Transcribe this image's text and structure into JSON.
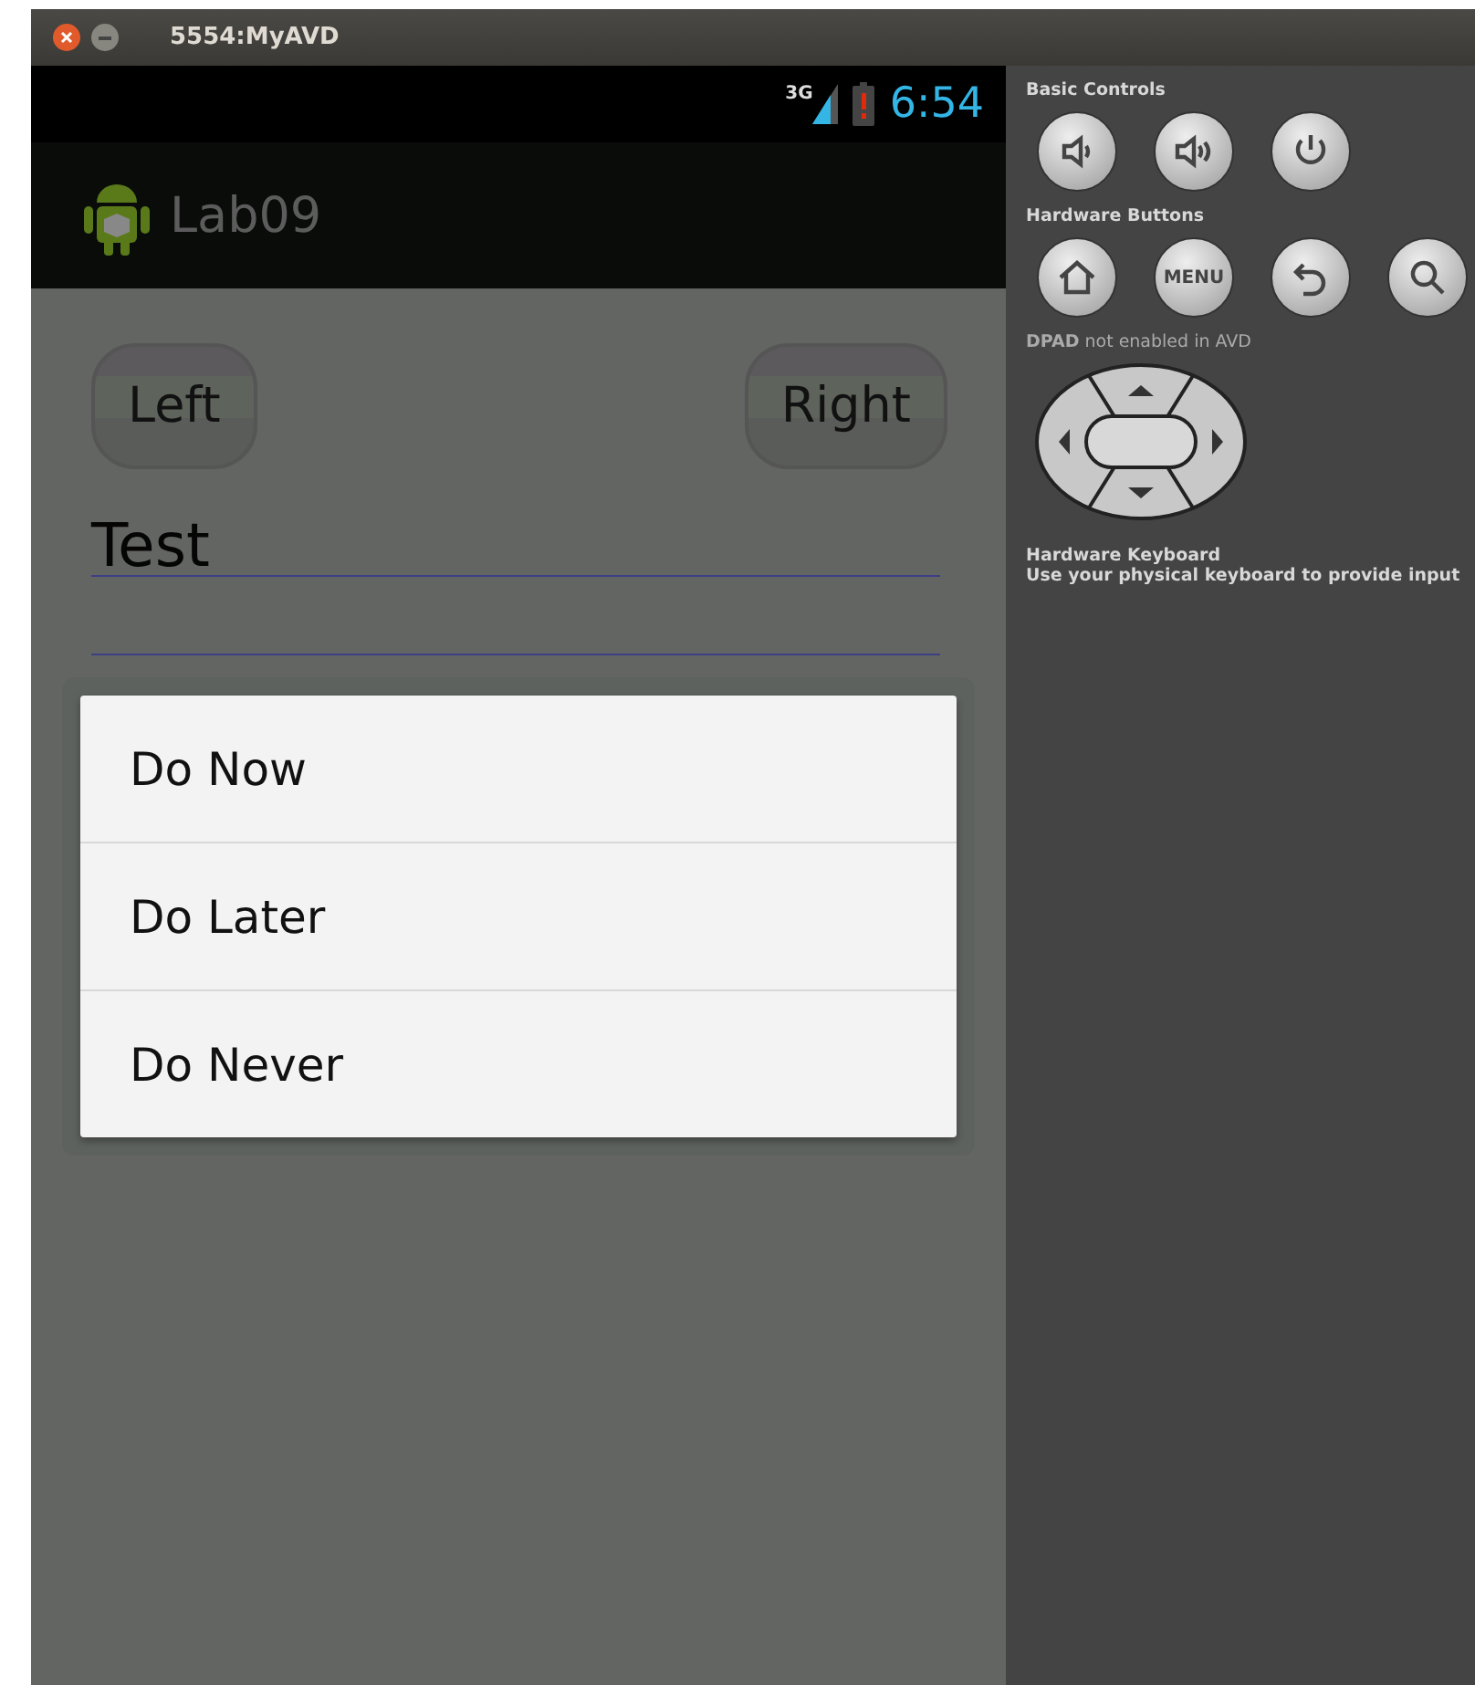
{
  "window": {
    "title": "5554:MyAVD"
  },
  "status_bar": {
    "network": "3G",
    "time": "6:54"
  },
  "action_bar": {
    "title": "Lab09"
  },
  "buttons": [
    {
      "label": "Left"
    },
    {
      "label": "Right"
    }
  ],
  "text_fields": [
    {
      "kind": "filled",
      "value": "Test"
    },
    {
      "kind": "empty"
    }
  ],
  "context_menu": {
    "items": [
      {
        "label": "Do Now"
      },
      {
        "label": "Do Later"
      },
      {
        "label": "Do Never"
      }
    ]
  },
  "controls_panel": {
    "sections": [
      {
        "kind": "buttons",
        "heading": "Basic Controls",
        "buttons": [
          {
            "kind": "volume-down"
          },
          {
            "kind": "volume-up"
          },
          {
            "kind": "power"
          }
        ]
      },
      {
        "kind": "buttons",
        "heading": "Hardware Buttons",
        "buttons": [
          {
            "kind": "home"
          },
          {
            "kind": "text",
            "label": "MENU"
          },
          {
            "kind": "back"
          },
          {
            "kind": "search"
          }
        ]
      },
      {
        "kind": "dpad",
        "heading": "**DPAD** not enabled in AVD"
      },
      {
        "kind": "note",
        "heading": "Hardware Keyboard",
        "text": "Use your physical keyboard to provide input"
      }
    ]
  }
}
